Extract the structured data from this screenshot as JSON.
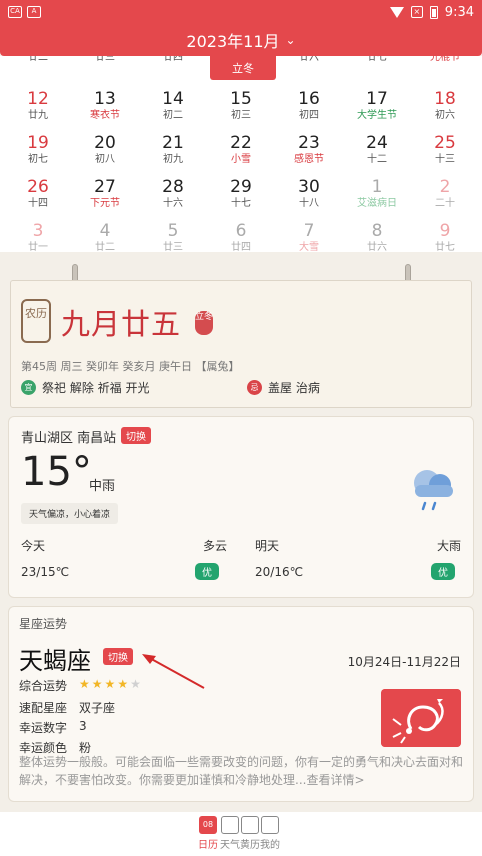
{
  "status_bar": {
    "time": "9:34",
    "left_icons": [
      "CA",
      "A"
    ]
  },
  "header": {
    "title": "2023年11月",
    "chevron": "chevron-down"
  },
  "selected_day_tab": {
    "label": "立冬"
  },
  "calendar_rows": [
    [
      {
        "num": "",
        "sub": "廿二",
        "weekend": true
      },
      {
        "num": "",
        "sub": "廿三"
      },
      {
        "num": "",
        "sub": "廿四"
      },
      {
        "num": "",
        "sub": ""
      },
      {
        "num": "",
        "sub": "廿六"
      },
      {
        "num": "",
        "sub": "廿七"
      },
      {
        "num": "",
        "sub": "光棍节",
        "weekend": true,
        "subClass": "red"
      }
    ],
    [
      {
        "num": "12",
        "sub": "廿九",
        "weekend": true
      },
      {
        "num": "13",
        "sub": "寒衣节",
        "subClass": "red"
      },
      {
        "num": "14",
        "sub": "初二"
      },
      {
        "num": "15",
        "sub": "初三"
      },
      {
        "num": "16",
        "sub": "初四"
      },
      {
        "num": "17",
        "sub": "大学生节",
        "subClass": "green"
      },
      {
        "num": "18",
        "sub": "初六",
        "weekend": true
      }
    ],
    [
      {
        "num": "19",
        "sub": "初七",
        "weekend": true
      },
      {
        "num": "20",
        "sub": "初八"
      },
      {
        "num": "21",
        "sub": "初九"
      },
      {
        "num": "22",
        "sub": "小雪",
        "subClass": "red"
      },
      {
        "num": "23",
        "sub": "感恩节",
        "subClass": "red"
      },
      {
        "num": "24",
        "sub": "十二"
      },
      {
        "num": "25",
        "sub": "十三",
        "weekend": true
      }
    ],
    [
      {
        "num": "26",
        "sub": "十四",
        "weekend": true
      },
      {
        "num": "27",
        "sub": "下元节",
        "subClass": "red"
      },
      {
        "num": "28",
        "sub": "十六"
      },
      {
        "num": "29",
        "sub": "十七"
      },
      {
        "num": "30",
        "sub": "十八"
      },
      {
        "num": "1",
        "sub": "艾滋病日",
        "dim": true,
        "subClass": "dimgreen"
      },
      {
        "num": "2",
        "sub": "二十",
        "weekend": true,
        "dim": true
      }
    ],
    [
      {
        "num": "3",
        "sub": "廿一",
        "weekend": true,
        "dim": true
      },
      {
        "num": "4",
        "sub": "廿二",
        "dim": true
      },
      {
        "num": "5",
        "sub": "廿三",
        "dim": true
      },
      {
        "num": "6",
        "sub": "廿四",
        "dim": true
      },
      {
        "num": "7",
        "sub": "大雪",
        "dim": true,
        "subClass": "dimred"
      },
      {
        "num": "8",
        "sub": "廿六",
        "dim": true
      },
      {
        "num": "9",
        "sub": "廿七",
        "weekend": true,
        "dim": true
      }
    ]
  ],
  "almanac": {
    "seal": "农历",
    "lunar_date": "九月廿五",
    "stamp": "立冬",
    "info": "第45周 周三 癸卯年 癸亥月 庚午日 【属兔】",
    "yi_icon": "宜",
    "yi": "祭祀 解除 祈福 开光",
    "ji_icon": "忌",
    "ji": "盖屋 治病"
  },
  "weather": {
    "location": "青山湖区 南昌站",
    "switch_label": "切换",
    "temperature": "15°",
    "condition": "中雨",
    "tip": "天气偏凉，小心着凉",
    "icon": "rain-cloud-icon",
    "today_label": "今天",
    "today_condition": "多云",
    "today_temp": "23/15℃",
    "today_quality": "优",
    "tomorrow_label": "明天",
    "tomorrow_condition": "大雨",
    "tomorrow_temp": "20/16℃",
    "tomorrow_quality": "优"
  },
  "horoscope": {
    "section_title": "星座运势",
    "sign": "天蝎座",
    "switch_label": "切换",
    "dates": "10月24日-11月22日",
    "overall_label": "综合运势",
    "overall_stars": 4,
    "overall_max": 5,
    "match_label": "速配星座",
    "match_value": "双子座",
    "lucky_number_label": "幸运数字",
    "lucky_number": "3",
    "lucky_color_label": "幸运颜色",
    "lucky_color": "粉",
    "description": "整体运势一般般。可能会面临一些需要改变的问题，你有一定的勇气和决心去面对和解决，不要害怕改变。你需要更加谨慎和冷静地处理...查看详情>",
    "art": "scorpion-icon"
  },
  "bottom_nav": {
    "tabs": [
      {
        "label": "日历",
        "active": true,
        "icon": "calendar-icon",
        "icon_text": "08"
      },
      {
        "label": "天气",
        "icon": "weather-icon"
      },
      {
        "label": "黄历",
        "icon": "almanac-icon"
      },
      {
        "label": "我的",
        "icon": "profile-icon"
      }
    ]
  },
  "colors": {
    "accent": "#e4484c",
    "good": "#23a46e",
    "star": "#f2b626"
  }
}
